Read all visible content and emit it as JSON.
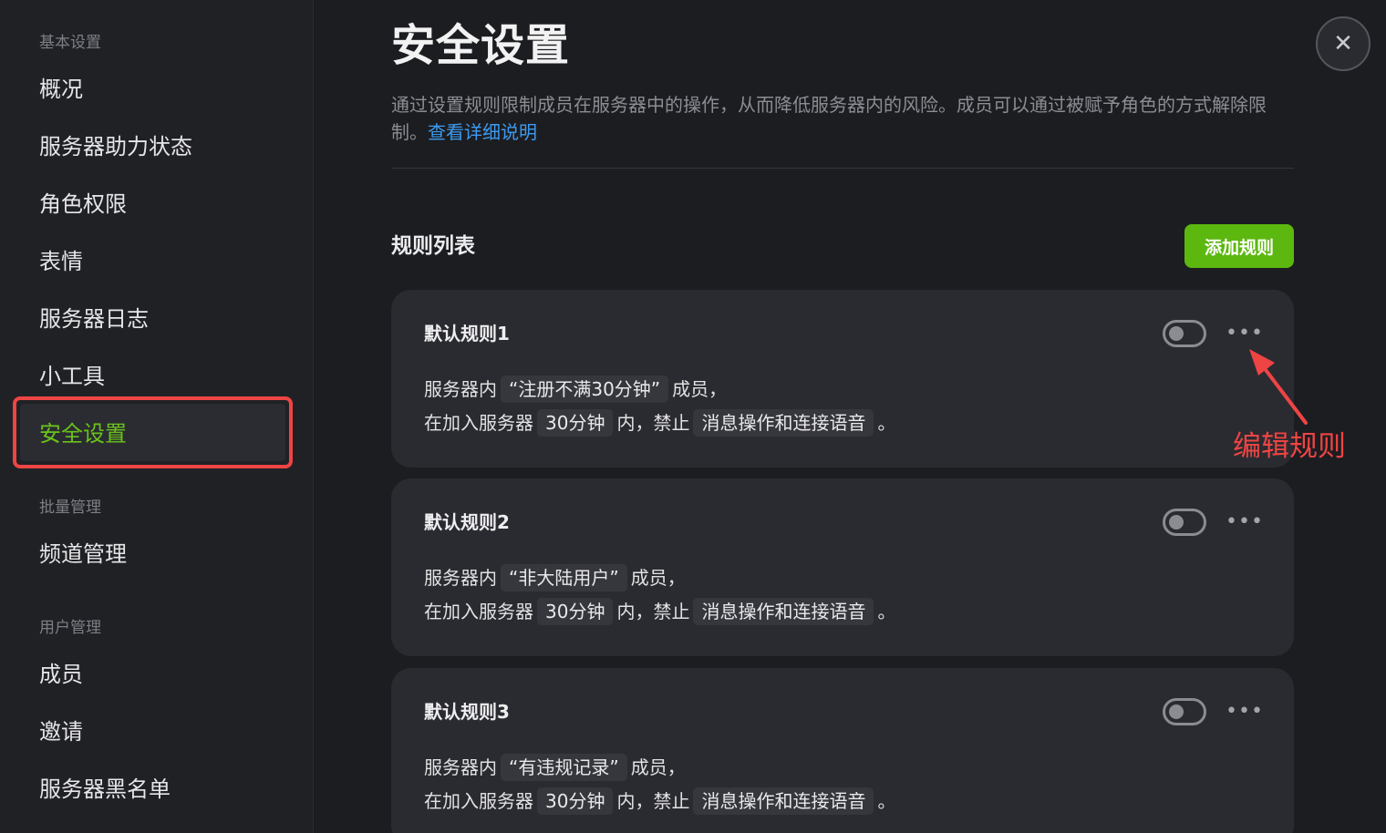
{
  "sidebar": {
    "groups": {
      "basic": "基本设置",
      "batch": "批量管理",
      "users": "用户管理"
    },
    "items": {
      "overview": "概况",
      "boost": "服务器助力状态",
      "roles": "角色权限",
      "emoji": "表情",
      "logs": "服务器日志",
      "tools": "小工具",
      "security": "安全设置",
      "channels": "频道管理",
      "members": "成员",
      "invites": "邀请",
      "blacklist": "服务器黑名单"
    },
    "active": "security"
  },
  "header": {
    "title": "安全设置",
    "description": "通过设置规则限制成员在服务器中的操作，从而降低服务器内的风险。成员可以通过被赋予角色的方式解除限制。",
    "link": "查看详细说明",
    "close_icon": "close-icon"
  },
  "rules_section": {
    "title": "规则列表",
    "add_button": "添加规则"
  },
  "rules": [
    {
      "title": "默认规则1",
      "enabled": false,
      "prefix": "服务器内",
      "condition": "“注册不满30分钟”",
      "members": "成员，",
      "join_prefix": "在加入服务器",
      "duration": "30分钟",
      "forbid": "内，禁止",
      "action": "消息操作和连接语音",
      "end": "。"
    },
    {
      "title": "默认规则2",
      "enabled": false,
      "prefix": "服务器内",
      "condition": "“非大陆用户”",
      "members": "成员，",
      "join_prefix": "在加入服务器",
      "duration": "30分钟",
      "forbid": "内，禁止",
      "action": "消息操作和连接语音",
      "end": "。"
    },
    {
      "title": "默认规则3",
      "enabled": false,
      "prefix": "服务器内",
      "condition": "“有违规记录”",
      "members": "成员，",
      "join_prefix": "在加入服务器",
      "duration": "30分钟",
      "forbid": "内，禁止",
      "action": "消息操作和连接语音",
      "end": "。"
    }
  ],
  "annotation": {
    "text": "编辑规则",
    "color": "#ef4444"
  },
  "colors": {
    "accent_green": "#5cb80f",
    "active_text": "#6ac31b",
    "link": "#3d9af0"
  }
}
